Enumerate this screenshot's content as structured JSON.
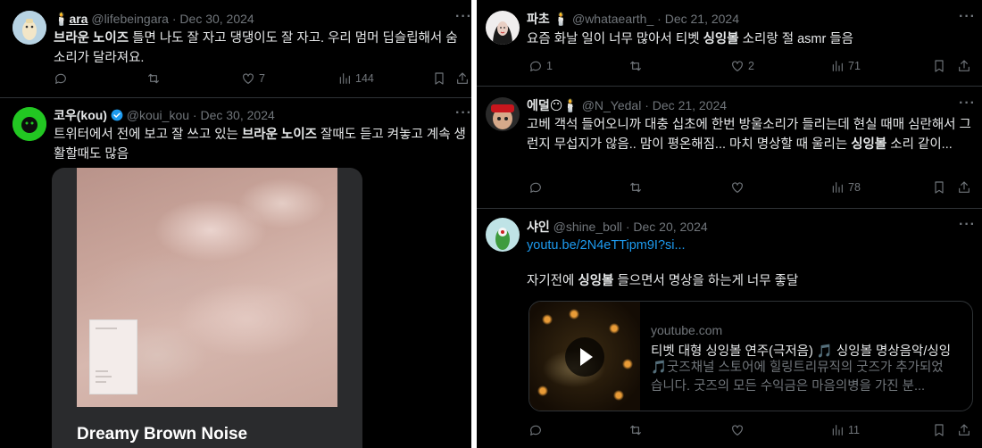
{
  "left": {
    "tweets": [
      {
        "name": "ara",
        "name_prefix": "🕯️",
        "handle": "@lifebeingara",
        "date": "Dec 30, 2024",
        "text_parts": [
          "",
          "브라운 노이즈",
          " 틀면 나도 잘 자고 댕댕이도 잘 자고. 우리 멈머 딥슬립해서 숨소리가 달라져요."
        ],
        "stats": {
          "replies": "",
          "retweets": "",
          "likes": "7",
          "views": "144"
        }
      },
      {
        "name": "코우(kou)",
        "handle": "@koui_kou",
        "date": "Dec 30, 2024",
        "text_parts": [
          "트위터에서 전에 보고 잘 쓰고 있는 ",
          "브라운 노이즈",
          " 잘때도 듣고 켜놓고 계속 생활할때도 많음"
        ],
        "media_title": "Dreamy Brown Noise"
      }
    ]
  },
  "right": {
    "tweets": [
      {
        "name": "파초",
        "name_suffix": "🕯️",
        "handle": "@whataearth_",
        "date": "Dec 21, 2024",
        "text_parts": [
          "요즘 화날 일이 너무 많아서 티벳 ",
          "싱잉볼",
          " 소리랑 절 asmr 들음"
        ],
        "stats": {
          "replies": "1",
          "retweets": "",
          "likes": "2",
          "views": "71"
        }
      },
      {
        "name": "에덜",
        "name_suffix": "😶🕯️",
        "handle": "@N_Yedal",
        "date": "Dec 21, 2024",
        "text_parts": [
          "고베 객석 들어오니까 대충 십초에 한번 방울소리가 들리는데 현실 때매 심란해서 그런지 무섭지가 않음.. 맘이 평온해짐... 마치 명상할 때 울리는 ",
          "싱잉볼",
          " 소리 같이..."
        ],
        "stats": {
          "replies": "",
          "retweets": "",
          "likes": "",
          "views": "78"
        }
      },
      {
        "name": "샤인",
        "handle": "@shine_boll",
        "date": "Dec 20, 2024",
        "link": "youtu.be/2N4eTTipm9I?si...",
        "text_parts": [
          "자기전에 ",
          "싱잉볼",
          " 들으면서 명상을 하는게 너무 좋달"
        ],
        "card": {
          "domain": "youtube.com",
          "title": "티벳 대형 싱잉볼 연주(극저음) 🎵 싱잉볼 명상음악/싱잉",
          "desc": "🎵굿즈채널 스토어에 힐링트리뮤직의 굿즈가 추가되었습니다. 굿즈의 모든 수익금은 마음의병을 가진 분..."
        },
        "stats": {
          "replies": "",
          "retweets": "",
          "likes": "",
          "views": "11"
        }
      }
    ]
  },
  "more_glyph": "···",
  "dot": "·",
  "colors": {
    "bg": "#000000",
    "text": "#e7e9ea",
    "muted": "#71767b",
    "link": "#1d9bf0",
    "verified": "#1d9bf0"
  }
}
